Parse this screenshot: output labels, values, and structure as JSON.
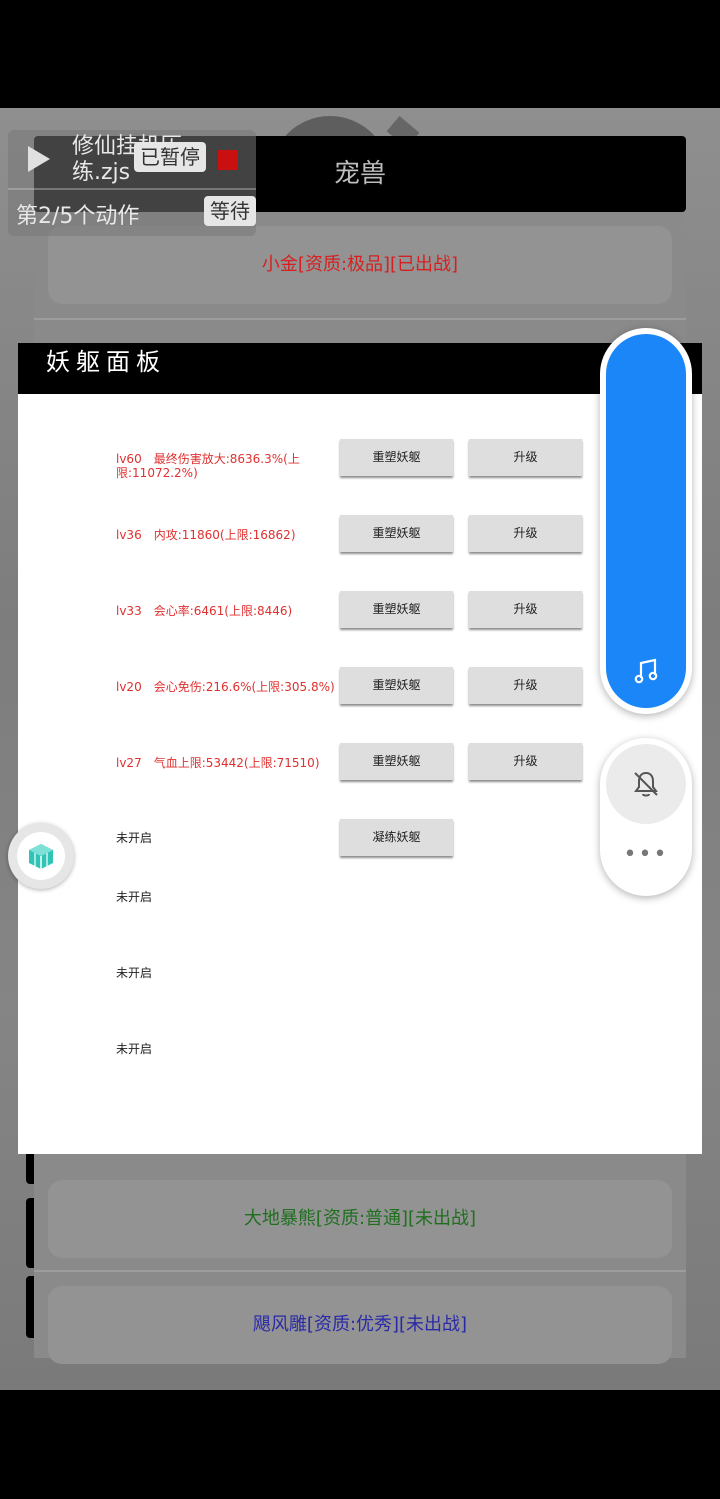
{
  "pet_panel": {
    "title": "宠兽",
    "pets": [
      {
        "label": "小金[资质:极品][已出战]",
        "color": "#d62020"
      },
      {
        "label": "大地暴熊[资质:普通][未出战]",
        "color": "#1f6f1f"
      },
      {
        "label": "飓风雕[资质:优秀][未出战]",
        "color": "#2a2aa8"
      }
    ]
  },
  "yao_panel": {
    "title": "妖躯面板",
    "slots": [
      {
        "text": "lv60　最终伤害放大:8636.3%(上限:11072.2%)",
        "remold": "重塑妖躯",
        "upgrade": "升级"
      },
      {
        "text": "lv36　内攻:11860(上限:16862)",
        "remold": "重塑妖躯",
        "upgrade": "升级"
      },
      {
        "text": "lv33　会心率:6461(上限:8446)",
        "remold": "重塑妖躯",
        "upgrade": "升级"
      },
      {
        "text": "lv20　会心免伤:216.6%(上限:305.8%)",
        "remold": "重塑妖躯",
        "upgrade": "升级"
      },
      {
        "text": "lv27　气血上限:53442(上限:71510)",
        "remold": "重塑妖躯",
        "upgrade": "升级"
      },
      {
        "text": "未开启",
        "refine": "凝练妖躯"
      },
      {
        "text": "未开启"
      },
      {
        "text": "未开启"
      },
      {
        "text": "未开启"
      }
    ]
  },
  "script_overlay": {
    "name": "修仙挂机历练.zjs",
    "status": "已暂停",
    "step": "第2/5个动作",
    "wait": "等待"
  },
  "side_controls": {
    "music_icon": "music-note-icon",
    "bell_icon": "bell-muted-icon",
    "more": "•••",
    "float_icon": "cube-icon"
  },
  "colors": {
    "accent": "#1a86f7",
    "stat_red": "#e03030",
    "stop_red": "#c81010"
  }
}
